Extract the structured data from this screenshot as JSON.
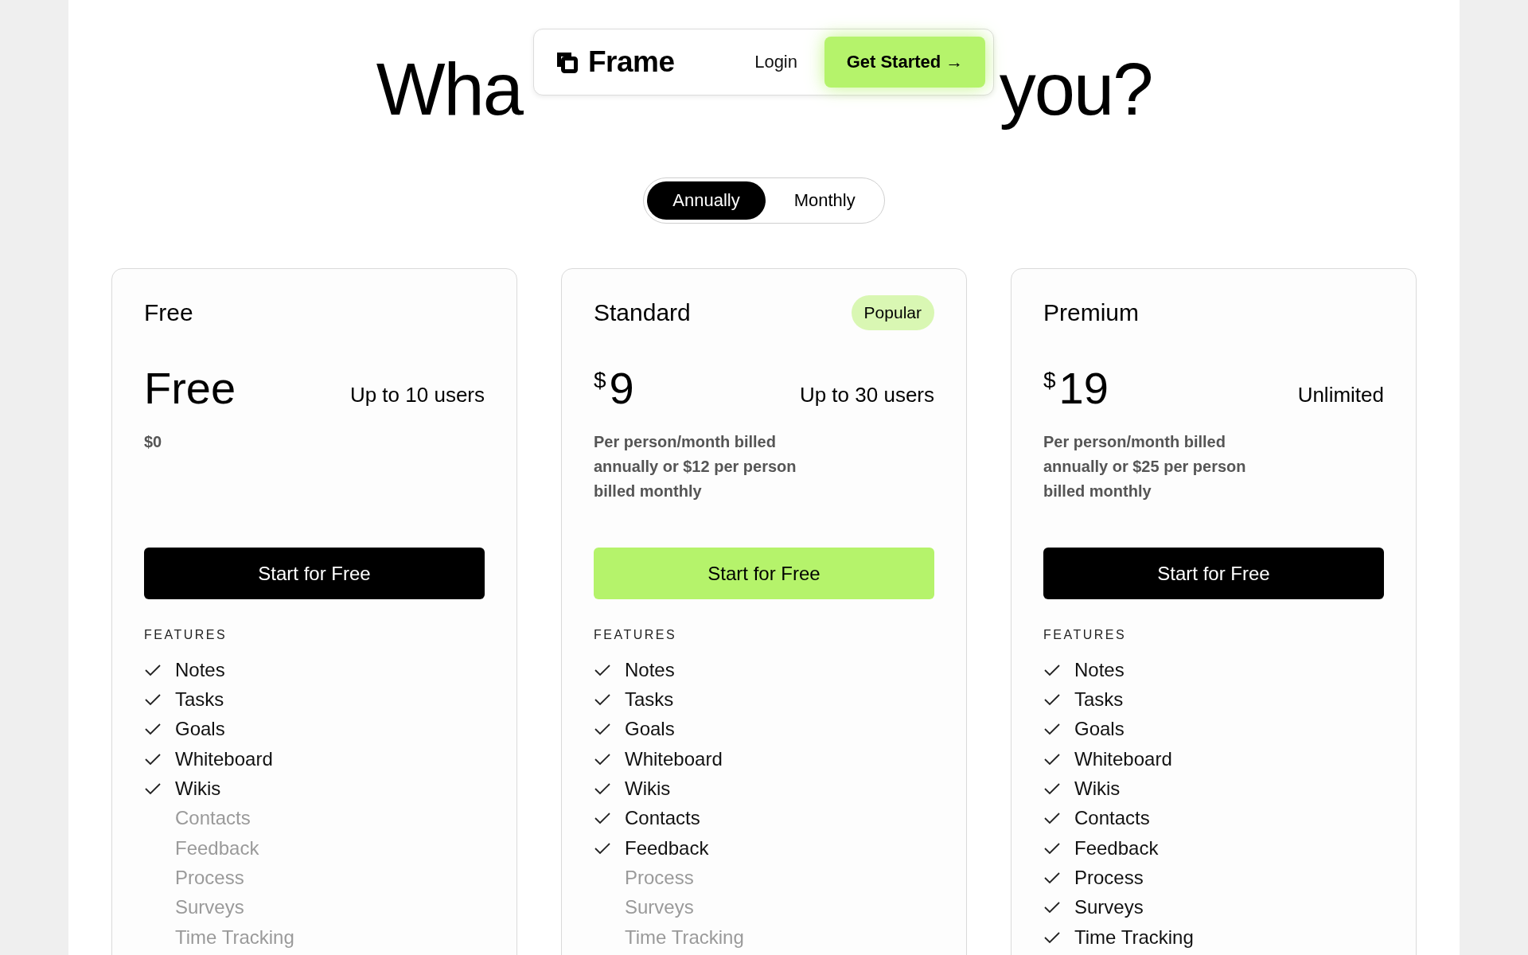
{
  "nav": {
    "brand": "Frame",
    "login": "Login",
    "cta": "Get Started →"
  },
  "heading": [
    "Wha",
    "you?"
  ],
  "billing_toggle": [
    {
      "label": "Annually",
      "selected": true
    },
    {
      "label": "Monthly",
      "selected": false
    }
  ],
  "plans": [
    {
      "name": "Free",
      "amount": "Free",
      "users": "Up to 10 users",
      "description": "$0",
      "button": {
        "label": "Start for Free",
        "kind": "dark"
      },
      "features_label": "FEATURES",
      "features": [
        {
          "label": "Notes",
          "included": true
        },
        {
          "label": "Tasks",
          "included": true
        },
        {
          "label": "Goals",
          "included": true
        },
        {
          "label": "Whiteboard",
          "included": true
        },
        {
          "label": "Wikis",
          "included": true
        },
        {
          "label": "Contacts",
          "included": false
        },
        {
          "label": "Feedback",
          "included": false
        },
        {
          "label": "Process",
          "included": false
        },
        {
          "label": "Surveys",
          "included": false
        },
        {
          "label": "Time Tracking",
          "included": false
        }
      ]
    },
    {
      "name": "Standard",
      "badge": "Popular",
      "currency": "$",
      "amount": "9",
      "users": "Up to 30 users",
      "description": "Per person/month billed annually or $12 per person billed monthly",
      "button": {
        "label": "Start for Free",
        "kind": "accent"
      },
      "features_label": "FEATURES",
      "features": [
        {
          "label": "Notes",
          "included": true
        },
        {
          "label": "Tasks",
          "included": true
        },
        {
          "label": "Goals",
          "included": true
        },
        {
          "label": "Whiteboard",
          "included": true
        },
        {
          "label": "Wikis",
          "included": true
        },
        {
          "label": "Contacts",
          "included": true
        },
        {
          "label": "Feedback",
          "included": true
        },
        {
          "label": "Process",
          "included": false
        },
        {
          "label": "Surveys",
          "included": false
        },
        {
          "label": "Time Tracking",
          "included": false
        }
      ]
    },
    {
      "name": "Premium",
      "currency": "$",
      "amount": "19",
      "users": "Unlimited",
      "description": "Per person/month billed annually or $25 per person billed monthly",
      "button": {
        "label": "Start for Free",
        "kind": "dark"
      },
      "features_label": "FEATURES",
      "features": [
        {
          "label": "Notes",
          "included": true
        },
        {
          "label": "Tasks",
          "included": true
        },
        {
          "label": "Goals",
          "included": true
        },
        {
          "label": "Whiteboard",
          "included": true
        },
        {
          "label": "Wikis",
          "included": true
        },
        {
          "label": "Contacts",
          "included": true
        },
        {
          "label": "Feedback",
          "included": true
        },
        {
          "label": "Process",
          "included": true
        },
        {
          "label": "Surveys",
          "included": true
        },
        {
          "label": "Time Tracking",
          "included": true
        }
      ]
    }
  ]
}
